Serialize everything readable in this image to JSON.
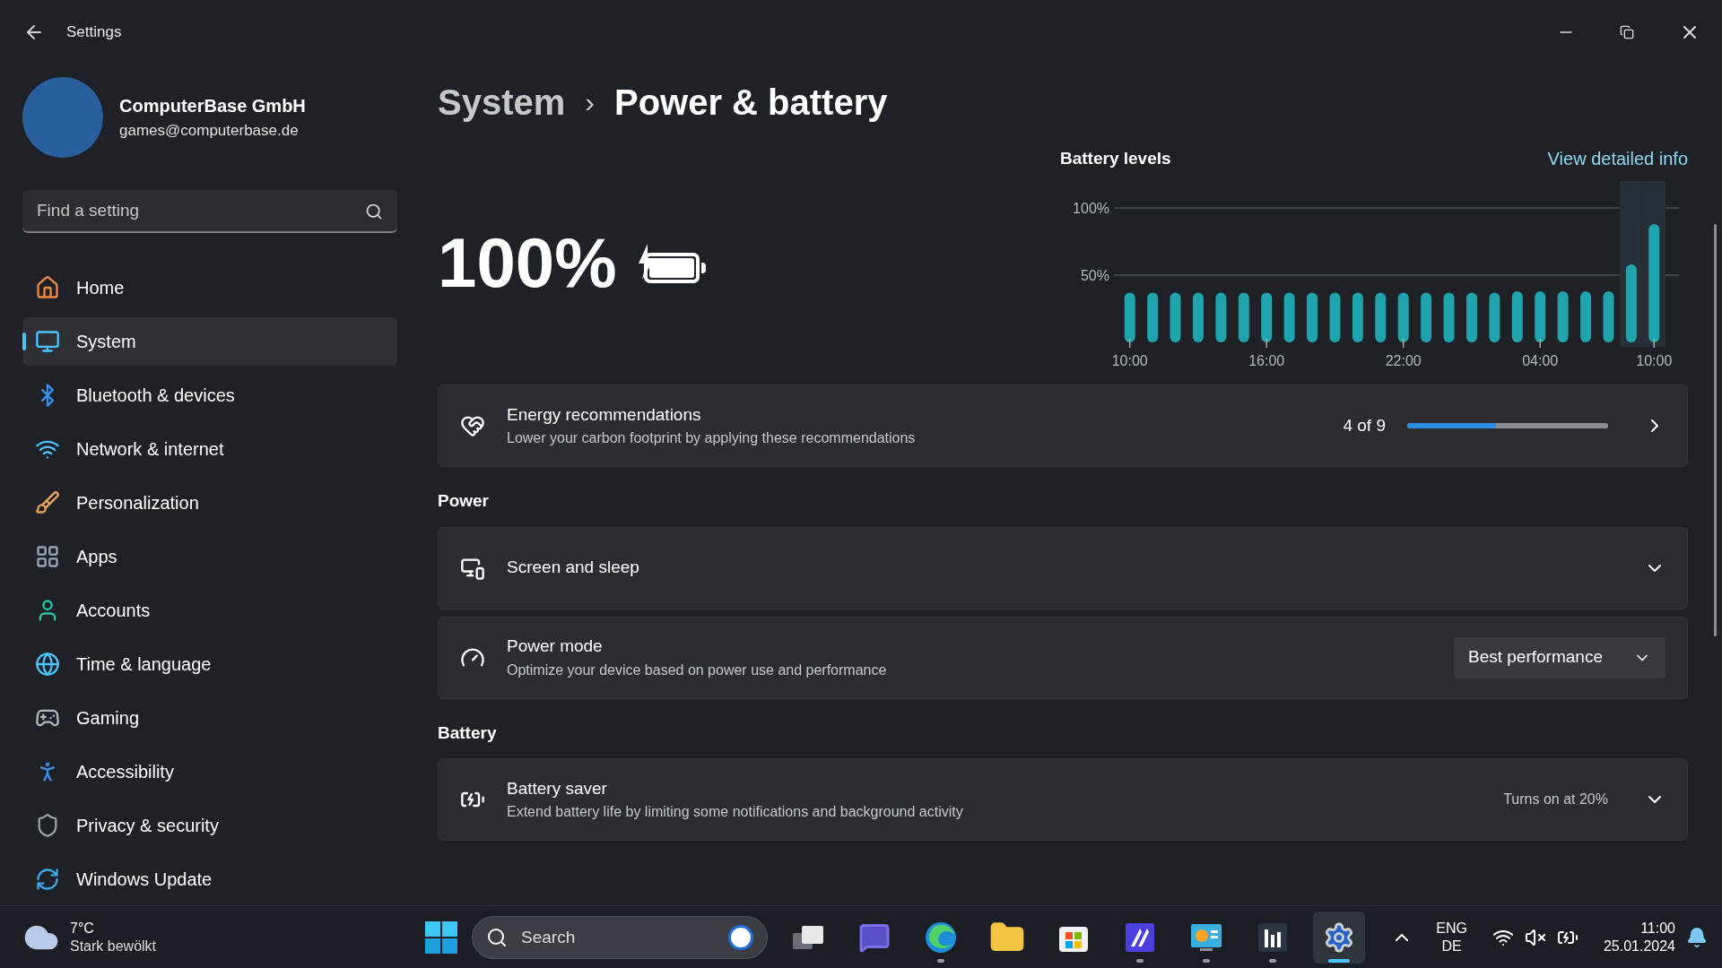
{
  "window": {
    "title": "Settings"
  },
  "profile": {
    "name": "ComputerBase GmbH",
    "email": "games@computerbase.de"
  },
  "search": {
    "placeholder": "Find a setting"
  },
  "sidebar": {
    "items": [
      {
        "kind": "home",
        "label": "Home",
        "selected": false
      },
      {
        "kind": "system",
        "label": "System",
        "selected": true
      },
      {
        "kind": "bluetooth",
        "label": "Bluetooth & devices",
        "selected": false
      },
      {
        "kind": "network",
        "label": "Network & internet",
        "selected": false
      },
      {
        "kind": "personalization",
        "label": "Personalization",
        "selected": false
      },
      {
        "kind": "apps",
        "label": "Apps",
        "selected": false
      },
      {
        "kind": "accounts",
        "label": "Accounts",
        "selected": false
      },
      {
        "kind": "time",
        "label": "Time & language",
        "selected": false
      },
      {
        "kind": "gaming",
        "label": "Gaming",
        "selected": false
      },
      {
        "kind": "accessibility",
        "label": "Accessibility",
        "selected": false
      },
      {
        "kind": "privacy",
        "label": "Privacy & security",
        "selected": false
      },
      {
        "kind": "update",
        "label": "Windows Update",
        "selected": false
      }
    ]
  },
  "breadcrumb": {
    "parent": "System",
    "separator": "›",
    "current": "Power & battery"
  },
  "battery": {
    "percent": "100%",
    "charging": true,
    "level": 1
  },
  "battery_levels": {
    "title": "Battery levels",
    "link": "View detailed info",
    "bar_charging": [
      false,
      false,
      false,
      false,
      false,
      false,
      false,
      false,
      false,
      false,
      false,
      false,
      false,
      false,
      false,
      false,
      false,
      false,
      false,
      false,
      false,
      false,
      true,
      true
    ],
    "chart_data": {
      "type": "bar",
      "categories": [
        "10:00",
        null,
        null,
        null,
        null,
        null,
        "16:00",
        null,
        null,
        null,
        null,
        null,
        "22:00",
        null,
        null,
        null,
        null,
        null,
        "04:00",
        null,
        null,
        null,
        null,
        "10:00"
      ],
      "values": [
        37,
        37,
        37,
        37,
        37,
        37,
        37,
        37,
        37,
        37,
        37,
        37,
        37,
        37,
        37,
        37,
        37,
        38,
        38,
        38,
        38,
        38,
        58,
        88
      ],
      "ylim": [
        0,
        100
      ],
      "yticks": [
        {
          "value": 50,
          "label": "50%"
        },
        {
          "value": 100,
          "label": "100%"
        }
      ]
    }
  },
  "energy": {
    "title": "Energy recommendations",
    "subtitle": "Lower your carbon footprint by applying these recommendations",
    "count": "4 of 9",
    "level": 0.444
  },
  "sections": [
    {
      "title": "Power",
      "cards": [
        {
          "kind": "expander",
          "title": "Screen and sleep",
          "expanded": false
        },
        {
          "kind": "dropdown",
          "title": "Power mode",
          "subtitle": "Optimize your device based on power use and performance",
          "value": "Best performance"
        }
      ]
    },
    {
      "title": "Battery",
      "cards": [
        {
          "kind": "expander",
          "title": "Battery saver",
          "subtitle": "Extend battery life by limiting some notifications and background activity",
          "status": "Turns on at 20%",
          "expanded": false
        }
      ]
    }
  ],
  "taskbar": {
    "weather": {
      "temp": "7°C",
      "condition": "Stark bewölkt"
    },
    "search_placeholder": "Search",
    "apps": [
      {
        "kind": "taskview",
        "running": false,
        "selected": false
      },
      {
        "kind": "chat",
        "running": false,
        "selected": false
      },
      {
        "kind": "edge",
        "running": true,
        "selected": false
      },
      {
        "kind": "explorer",
        "running": false,
        "selected": false
      },
      {
        "kind": "store",
        "running": false,
        "selected": false
      },
      {
        "kind": "studio",
        "running": true,
        "selected": false
      },
      {
        "kind": "dashboard",
        "running": true,
        "selected": false
      },
      {
        "kind": "bars",
        "running": true,
        "selected": false
      },
      {
        "kind": "settings",
        "running": true,
        "selected": true
      }
    ],
    "language": [
      "ENG",
      "DE"
    ],
    "time": "11:00",
    "date": "25.01.2024"
  }
}
